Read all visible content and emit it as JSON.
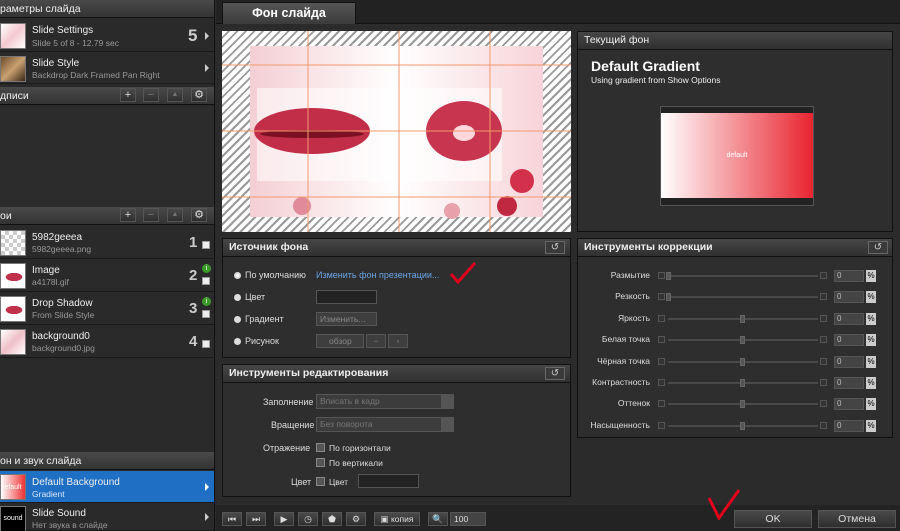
{
  "left": {
    "slide_params_header": "раметры слайда",
    "slide_settings": {
      "title": "Slide Settings",
      "sub": "Slide 5 of 8 - 12.79 sec",
      "num": "5"
    },
    "slide_style": {
      "title": "Slide Style",
      "sub": "Backdrop Dark Framed Pan Right"
    },
    "captions_header": "дписи",
    "layers_header": "ои",
    "layers": [
      {
        "title": "5982geeea",
        "sub": "5982geeea.png",
        "num": "1",
        "info": false
      },
      {
        "title": "Image",
        "sub": "a4178l.gif",
        "num": "2",
        "info": true
      },
      {
        "title": "Drop Shadow",
        "sub": "From Slide Style",
        "num": "3",
        "info": true
      },
      {
        "title": "background0",
        "sub": "background0.jpg",
        "num": "4",
        "info": false
      }
    ],
    "bg_sound_header": "он и звук слайда",
    "default_bg": {
      "title": "Default Background",
      "sub": "Gradient",
      "thumb": "efault"
    },
    "slide_sound": {
      "title": "Slide Sound",
      "sub": "Нет звука в слайде",
      "thumb": "sound"
    }
  },
  "tab": {
    "label": "Фон слайда"
  },
  "current_bg": {
    "header": "Текущий фон",
    "title": "Default Gradient",
    "subtitle": "Using gradient from Show Options",
    "preview_label": "default"
  },
  "source": {
    "header": "Источник фона",
    "default_label": "По умолчанию",
    "change_link": "Изменить фон презентации...",
    "color_label": "Цвет",
    "gradient_label": "Градиент",
    "gradient_btn": "Изменить...",
    "image_label": "Рисунок",
    "browse_btn": "обзор"
  },
  "edit": {
    "header": "Инструменты редактирования",
    "fill_label": "Заполнение",
    "fill_value": "Вписать в кадр",
    "rotation_label": "Вращение",
    "rotation_value": "Без поворота",
    "reflection_label": "Отражение",
    "horizontal": "По горизонтали",
    "vertical": "По вертикали",
    "color_label": "Цвет",
    "color_check": "Цвет"
  },
  "correction": {
    "header": "Инструменты коррекции",
    "items": [
      {
        "label": "Размытие",
        "value": "0",
        "thumb": 0
      },
      {
        "label": "Резкость",
        "value": "0",
        "thumb": 0
      },
      {
        "label": "Яркость",
        "value": "0",
        "thumb": 0.5
      },
      {
        "label": "Белая точка",
        "value": "0",
        "thumb": 0.5
      },
      {
        "label": "Чёрная точка",
        "value": "0",
        "thumb": 0.5
      },
      {
        "label": "Контрастность",
        "value": "0",
        "thumb": 0.5
      },
      {
        "label": "Оттенок",
        "value": "0",
        "thumb": 0.5
      },
      {
        "label": "Насыщенность",
        "value": "0",
        "thumb": 0.5
      }
    ],
    "unit": "%"
  },
  "bottom": {
    "copy": "копия",
    "zoom": "100",
    "ok": "OK",
    "cancel": "Отмена"
  },
  "colors": {
    "accent_selected": "#1f6fc4",
    "check_mark": "#e0001b"
  }
}
